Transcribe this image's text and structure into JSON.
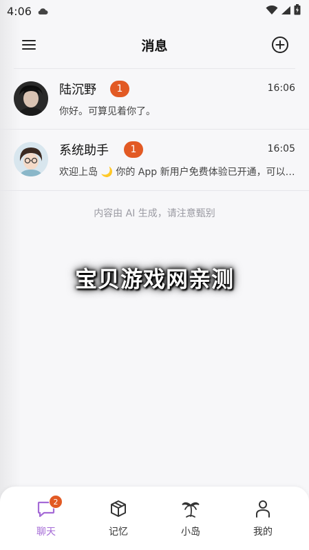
{
  "status_bar": {
    "time": "4:06"
  },
  "header": {
    "title": "消息"
  },
  "chats": [
    {
      "name": "陆沉野",
      "unread": "1",
      "time": "16:06",
      "preview": "你好。可算见着你了。"
    },
    {
      "name": "系统助手",
      "unread": "1",
      "time": "16:05",
      "preview": "欢迎上岛 🌙 你的 App 新用户免费体验已开通，可以开始聊天了"
    }
  ],
  "ai_notice": "内容由 AI 生成，请注意甄别",
  "watermark": "宝贝游戏网亲测",
  "bottom_nav": {
    "items": [
      {
        "label": "聊天",
        "badge": "2",
        "icon": "chat-bubble-icon",
        "active": true
      },
      {
        "label": "记忆",
        "icon": "box-icon"
      },
      {
        "label": "小岛",
        "icon": "palm-tree-icon"
      },
      {
        "label": "我的",
        "icon": "person-icon"
      }
    ]
  },
  "colors": {
    "accent": "#a46ad6",
    "badge": "#e25a24",
    "background": "#f7f7f9"
  }
}
